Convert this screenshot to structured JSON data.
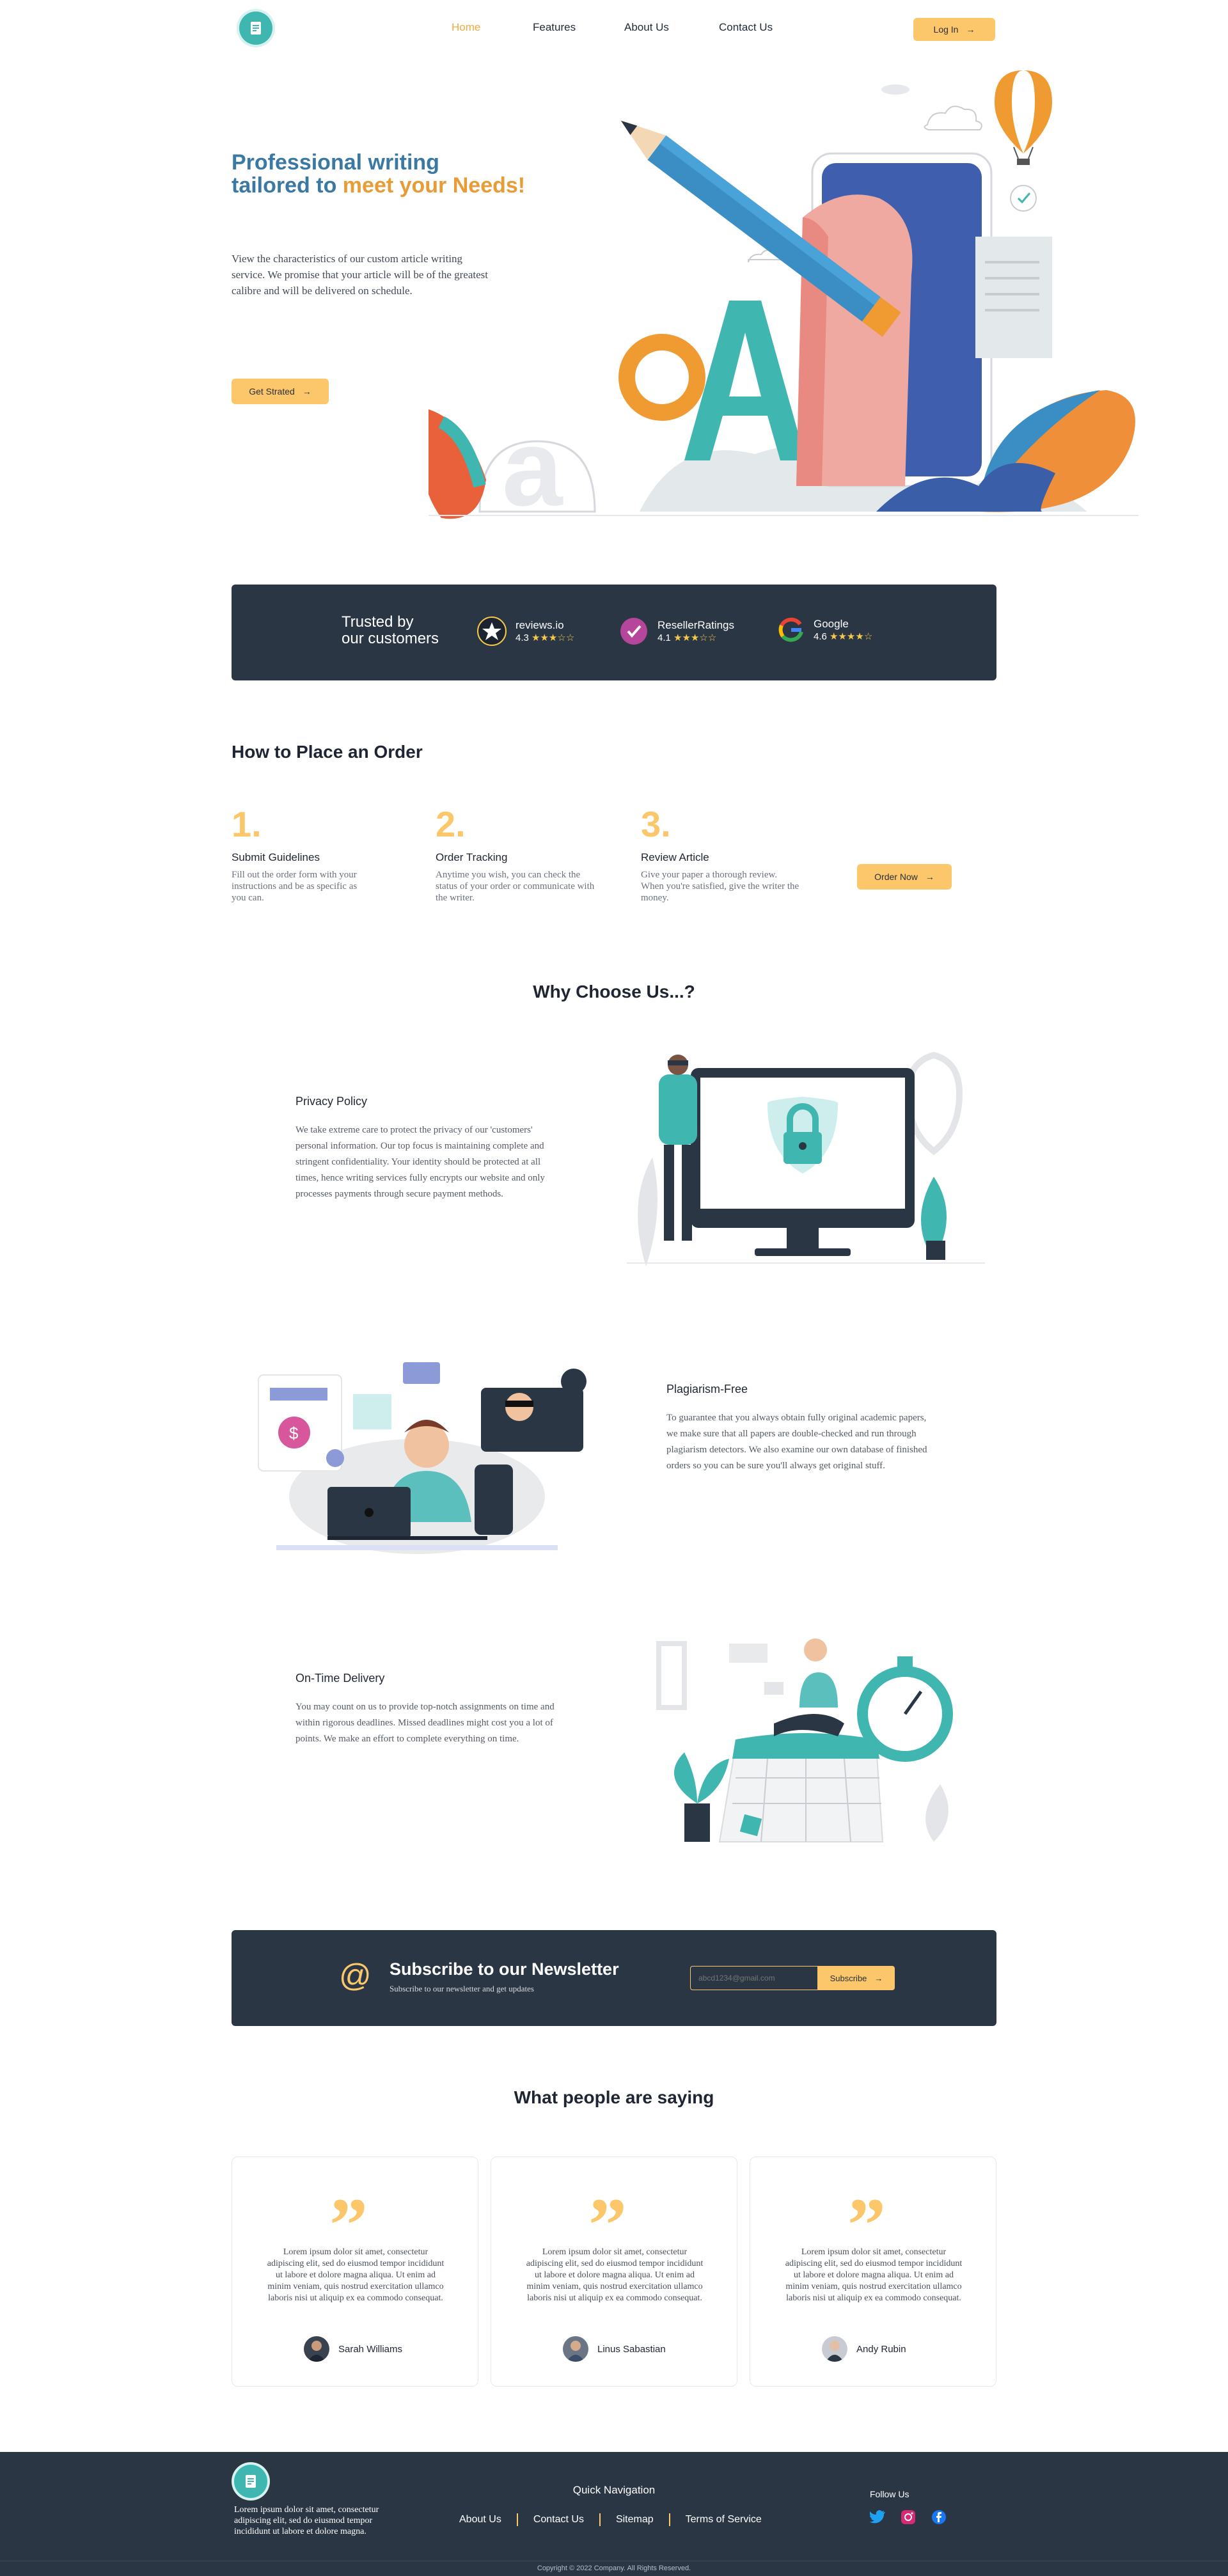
{
  "nav": {
    "links": [
      "Home",
      "Features",
      "About Us",
      "Contact Us"
    ],
    "login_label": "Log In"
  },
  "hero": {
    "title_line1": "Professional writing",
    "title_line2a": "tailored to ",
    "title_line2b": "meet your Needs!",
    "text": "View the characteristics of our custom article writing service. We promise that your article will be of the greatest calibre and will be delivered on schedule.",
    "cta_label": "Get Strated"
  },
  "trust": {
    "heading_line1": "Trusted by",
    "heading_line2": "our customers",
    "ratings": [
      {
        "name": "reviews.io",
        "score": "4.3",
        "stars": 3.5,
        "icon": "star-badge-icon"
      },
      {
        "name": "ResellerRatings",
        "score": "4.1",
        "stars": 3,
        "icon": "check-badge-icon"
      },
      {
        "name": "Google",
        "score": "4.6",
        "stars": 4.5,
        "icon": "google-icon"
      }
    ]
  },
  "order": {
    "heading": "How to Place an Order",
    "steps": [
      {
        "num": "1.",
        "title": "Submit Guidelines",
        "text": "Fill out the order form with your instructions and be as specific as you can."
      },
      {
        "num": "2.",
        "title": "Order Tracking",
        "text": "Anytime you wish, you can check the status of your order or communicate with the writer."
      },
      {
        "num": "3.",
        "title": "Review Article",
        "text": "Give your paper a thorough review. When you're satisfied, give the writer the money."
      }
    ],
    "cta_label": "Order Now"
  },
  "why": {
    "heading": "Why Choose Us...?",
    "features": [
      {
        "title": "Privacy Policy",
        "text": "We take extreme care to protect the privacy of our 'customers' personal information. Our top focus is maintaining complete and stringent confidentiality. Your identity should be protected at all times, hence  writing services fully encrypts our website and only processes payments through secure payment methods."
      },
      {
        "title": "Plagiarism-Free",
        "text": "To guarantee that you  always obtain fully original academic papers, we make sure that all papers are double-checked and run through plagiarism detectors. We also examine our own database of finished orders so you can be sure you'll always get original stuff."
      },
      {
        "title": "On-Time Delivery",
        "text": "You may count on us to provide top-notch assignments on time and within rigorous deadlines. Missed deadlines might cost you a lot of points. We make an effort to complete everything on time."
      }
    ]
  },
  "newsletter": {
    "title": "Subscribe to our Newsletter",
    "subtitle": "Subscribe to our newsletter and get updates",
    "email_placeholder": "abcd1234@gmail.com",
    "button_label": "Subscribe"
  },
  "testimonials": {
    "heading": "What people are saying",
    "items": [
      {
        "text": "Lorem ipsum dolor sit amet, consectetur adipiscing elit, sed do eiusmod tempor incididunt ut labore et dolore magna aliqua. Ut enim ad minim veniam, quis nostrud exercitation ullamco laboris nisi ut aliquip ex ea commodo consequat.",
        "name": "Sarah Williams"
      },
      {
        "text": "Lorem ipsum dolor sit amet, consectetur adipiscing elit, sed do eiusmod tempor incididunt ut labore et dolore magna aliqua. Ut enim ad minim veniam, quis nostrud exercitation ullamco laboris nisi ut aliquip ex ea commodo consequat.",
        "name": "Linus Sabastian"
      },
      {
        "text": "Lorem ipsum dolor sit amet, consectetur adipiscing elit, sed do eiusmod tempor incididunt ut labore et dolore magna aliqua. Ut enim ad minim veniam, quis nostrud exercitation ullamco laboris nisi ut aliquip ex ea commodo consequat.",
        "name": "Andy Rubin"
      }
    ]
  },
  "footer": {
    "about_text": "Lorem ipsum dolor sit amet, consectetur adipiscing elit, sed do eiusmod tempor incididunt ut labore et dolore magna.",
    "quick_nav_title": "Quick Navigation",
    "links": [
      "About Us",
      "Contact Us",
      "Sitemap",
      "Terms of Service"
    ],
    "follow_title": "Follow Us",
    "copyright": "Copyright © 2022 Company. All Rights Reserved."
  }
}
